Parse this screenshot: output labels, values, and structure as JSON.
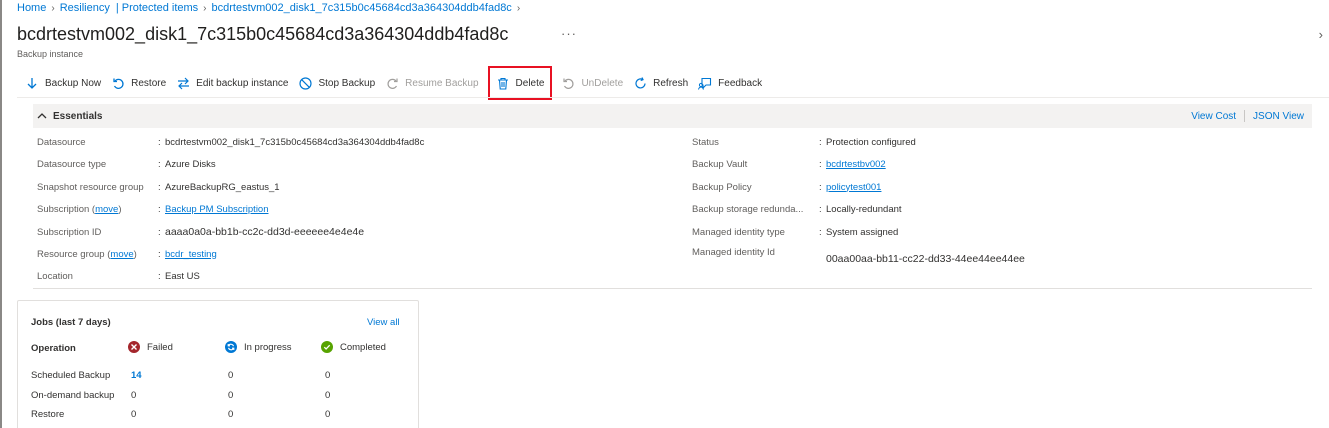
{
  "breadcrumb": {
    "items": [
      "Home",
      "Resiliency",
      "| Protected items",
      "bcdrtestvm002_disk1_7c315b0c45684cd3a364304ddb4fad8c"
    ]
  },
  "header": {
    "title": "bcdrtestvm002_disk1_7c315b0c45684cd3a364304ddb4fad8c",
    "subtitle": "Backup instance",
    "more": "···"
  },
  "toolbar": {
    "backup_now": "Backup Now",
    "restore": "Restore",
    "edit": "Edit backup instance",
    "stop": "Stop Backup",
    "resume": "Resume Backup",
    "delete": "Delete",
    "undelete": "UnDelete",
    "refresh": "Refresh",
    "feedback": "Feedback"
  },
  "essentials": {
    "label": "Essentials",
    "view_cost": "View Cost",
    "json_view": "JSON View",
    "colon": ":",
    "move": "move",
    "left": {
      "datasource_k": "Datasource",
      "datasource_v": "bcdrtestvm002_disk1_7c315b0c45684cd3a364304ddb4fad8c",
      "datasource_type_k": "Datasource type",
      "datasource_type_v": "Azure Disks",
      "snapshot_rg_k": "Snapshot resource group",
      "snapshot_rg_v": "AzureBackupRG_eastus_1",
      "subscription_k": "Subscription",
      "subscription_v": "Backup PM Subscription",
      "subscription_id_k": "Subscription ID",
      "subscription_id_v": "aaaa0a0a-bb1b-cc2c-dd3d-eeeeee4e4e4e",
      "resource_group_k": "Resource group",
      "resource_group_v": "bcdr_testing",
      "location_k": "Location",
      "location_v": "East US"
    },
    "right": {
      "status_k": "Status",
      "status_v": "Protection configured",
      "vault_k": "Backup Vault",
      "vault_v": "bcdrtestbv002",
      "policy_k": "Backup Policy",
      "policy_v": "policytest001",
      "redundancy_k": "Backup storage redunda...",
      "redundancy_v": "Locally-redundant",
      "mi_type_k": "Managed identity type",
      "mi_type_v": "System assigned",
      "mi_id_k": "Managed identity Id",
      "mi_id_v": "00aa00aa-bb11-cc22-dd33-44ee44ee44ee"
    }
  },
  "jobs": {
    "title": "Jobs (last 7 days)",
    "view_all": "View all",
    "operation": "Operation",
    "failed": "Failed",
    "in_progress": "In progress",
    "completed": "Completed",
    "rows": [
      {
        "name": "Scheduled Backup",
        "failed": "14",
        "in_progress": "0",
        "completed": "0"
      },
      {
        "name": "On-demand backup",
        "failed": "0",
        "in_progress": "0",
        "completed": "0"
      },
      {
        "name": "Restore",
        "failed": "0",
        "in_progress": "0",
        "completed": "0"
      }
    ]
  },
  "colors": {
    "accent": "#0078d4",
    "failed": "#a4262c",
    "in_progress": "#0078d4",
    "completed": "#57a300",
    "highlight": "#e81123"
  }
}
